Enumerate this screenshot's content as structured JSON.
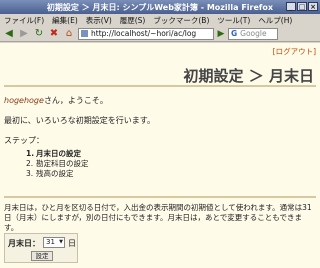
{
  "window": {
    "title": "初期設定 ＞ 月末日: シンプルWeb家計簿 - Mozilla Firefox"
  },
  "menu": [
    "ファイル(F)",
    "編集(E)",
    "表示(V)",
    "履歴(S)",
    "ブックマーク(B)",
    "ツール(T)",
    "ヘルプ(H)"
  ],
  "toolbar": {
    "url": "http://localhost/~hori/ac/log",
    "search_placeholder": "Google"
  },
  "page": {
    "logout": "[ログアウト]",
    "heading": "初期設定 ＞ 月末日",
    "user": "hogehoge",
    "greeting_suffix": "さん，ようこそ。",
    "intro": "最初に、いろいろな初期設定を行います。",
    "steps_label": "ステップ：",
    "steps": [
      {
        "num": "1.",
        "label": "月末日の設定"
      },
      {
        "num": "2.",
        "label": "勘定科目の設定"
      },
      {
        "num": "3.",
        "label": "残高の設定"
      }
    ],
    "description": "月末日は，ひと月を区切る日付で，入出金の表示期間の初期値として使われます。通常は31日（月末）にしますが，別の日付にもできます。月末日は，あとで変更することもできます。",
    "form": {
      "label": "月末日：",
      "day_value": "31",
      "day_unit": "日",
      "submit": "設定"
    }
  }
}
